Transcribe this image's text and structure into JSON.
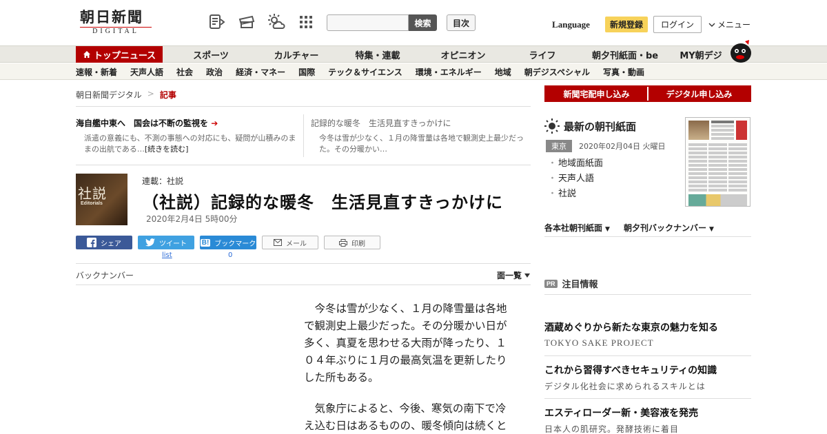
{
  "header": {
    "logo_main": "朝日新聞",
    "logo_sub": "DIGITAL",
    "icons": [
      "edition-list-icon",
      "ticket-icon",
      "weather-icon",
      "grid-apps-icon"
    ],
    "search_placeholder": "",
    "search_button": "検索",
    "toc_button": "目次",
    "language": "Language",
    "register": "新規登録",
    "login": "ログイン",
    "menu": "メニュー"
  },
  "mainnav": [
    "トップニュース",
    "スポーツ",
    "カルチャー",
    "特集・連載",
    "オピニオン",
    "ライフ",
    "朝夕刊紙面・be",
    "MY朝デジ"
  ],
  "subnav": [
    "速報・新着",
    "天声人語",
    "社会",
    "政治",
    "経済・マネー",
    "国際",
    "テック＆サイエンス",
    "環境・エネルギー",
    "地域",
    "朝デジスペシャル",
    "写真・動画"
  ],
  "breadcrumb": {
    "root": "朝日新聞デジタル",
    "sep": ">",
    "current": "記事"
  },
  "related": [
    {
      "title": "海自艦中東へ　国会は不断の監視を",
      "body": "派遣の意義にも、不測の事態への対応にも、疑問が山積みのままの出航である…",
      "more": "[続きを読む]"
    },
    {
      "title": "記録的な暖冬　生活見直すきっかけに",
      "body": "今冬は雪が少なく、１月の降雪量は各地で観測史上最少だった。その分暖かい…"
    }
  ],
  "article": {
    "thumb_title": "社説",
    "thumb_sub": "Editorials",
    "series": "連載：社説",
    "title": "（社説）記録的な暖冬　生活見直すきっかけに",
    "date": "2020年2月4日 5時00分",
    "paragraphs": [
      "今冬は雪が少なく、１月の降雪量は各地で観測史上最少だった。その分暖かい日が多く、真夏を思わせる大雨が降ったり、１０４年ぶりに１月の最高気温を更新したりした所もある。",
      "気象庁によると、今後、寒気の南下で冷え込む日はあるものの、暖冬傾向は続くと"
    ]
  },
  "share": {
    "facebook": "シェア",
    "twitter": "ツイート",
    "twitter_sub": "list",
    "hatena": "ブックマーク",
    "hatena_count": "0",
    "mail": "メール",
    "print": "印刷"
  },
  "backnumber": "バックナンバー",
  "menulist": "面一覧",
  "sidebar": {
    "order_home": "新聞宅配申し込み",
    "order_digital": "デジタル申し込み",
    "paper_title": "最新の朝刊紙面",
    "edition_tag": "東京",
    "edition_date": "2020年02月04日 火曜日",
    "paper_links": [
      "地域面紙面",
      "天声人語",
      "社説"
    ],
    "dropmenus": [
      "各本社朝刊紙面",
      "朝夕刊バックナンバー"
    ],
    "pr_badge": "PR",
    "pr_title": "注目情報",
    "ads": [
      {
        "headline": "酒蔵めぐりから新たな東京の魅力を知る",
        "sub": "TOKYO SAKE PROJECT"
      },
      {
        "headline": "これから習得すべきセキュリティの知識",
        "sub": "デジタル化社会に求められるスキルとは"
      },
      {
        "headline": "エスティローダー新・美容液を発売",
        "sub": "日本人の肌研究。発酵技術に着目"
      }
    ]
  },
  "colors": {
    "brand_red": "#b30000",
    "register_yellow": "#f7d25a",
    "facebook": "#3b5998",
    "twitter": "#3fa1e1",
    "hatena": "#2a8ad6"
  }
}
